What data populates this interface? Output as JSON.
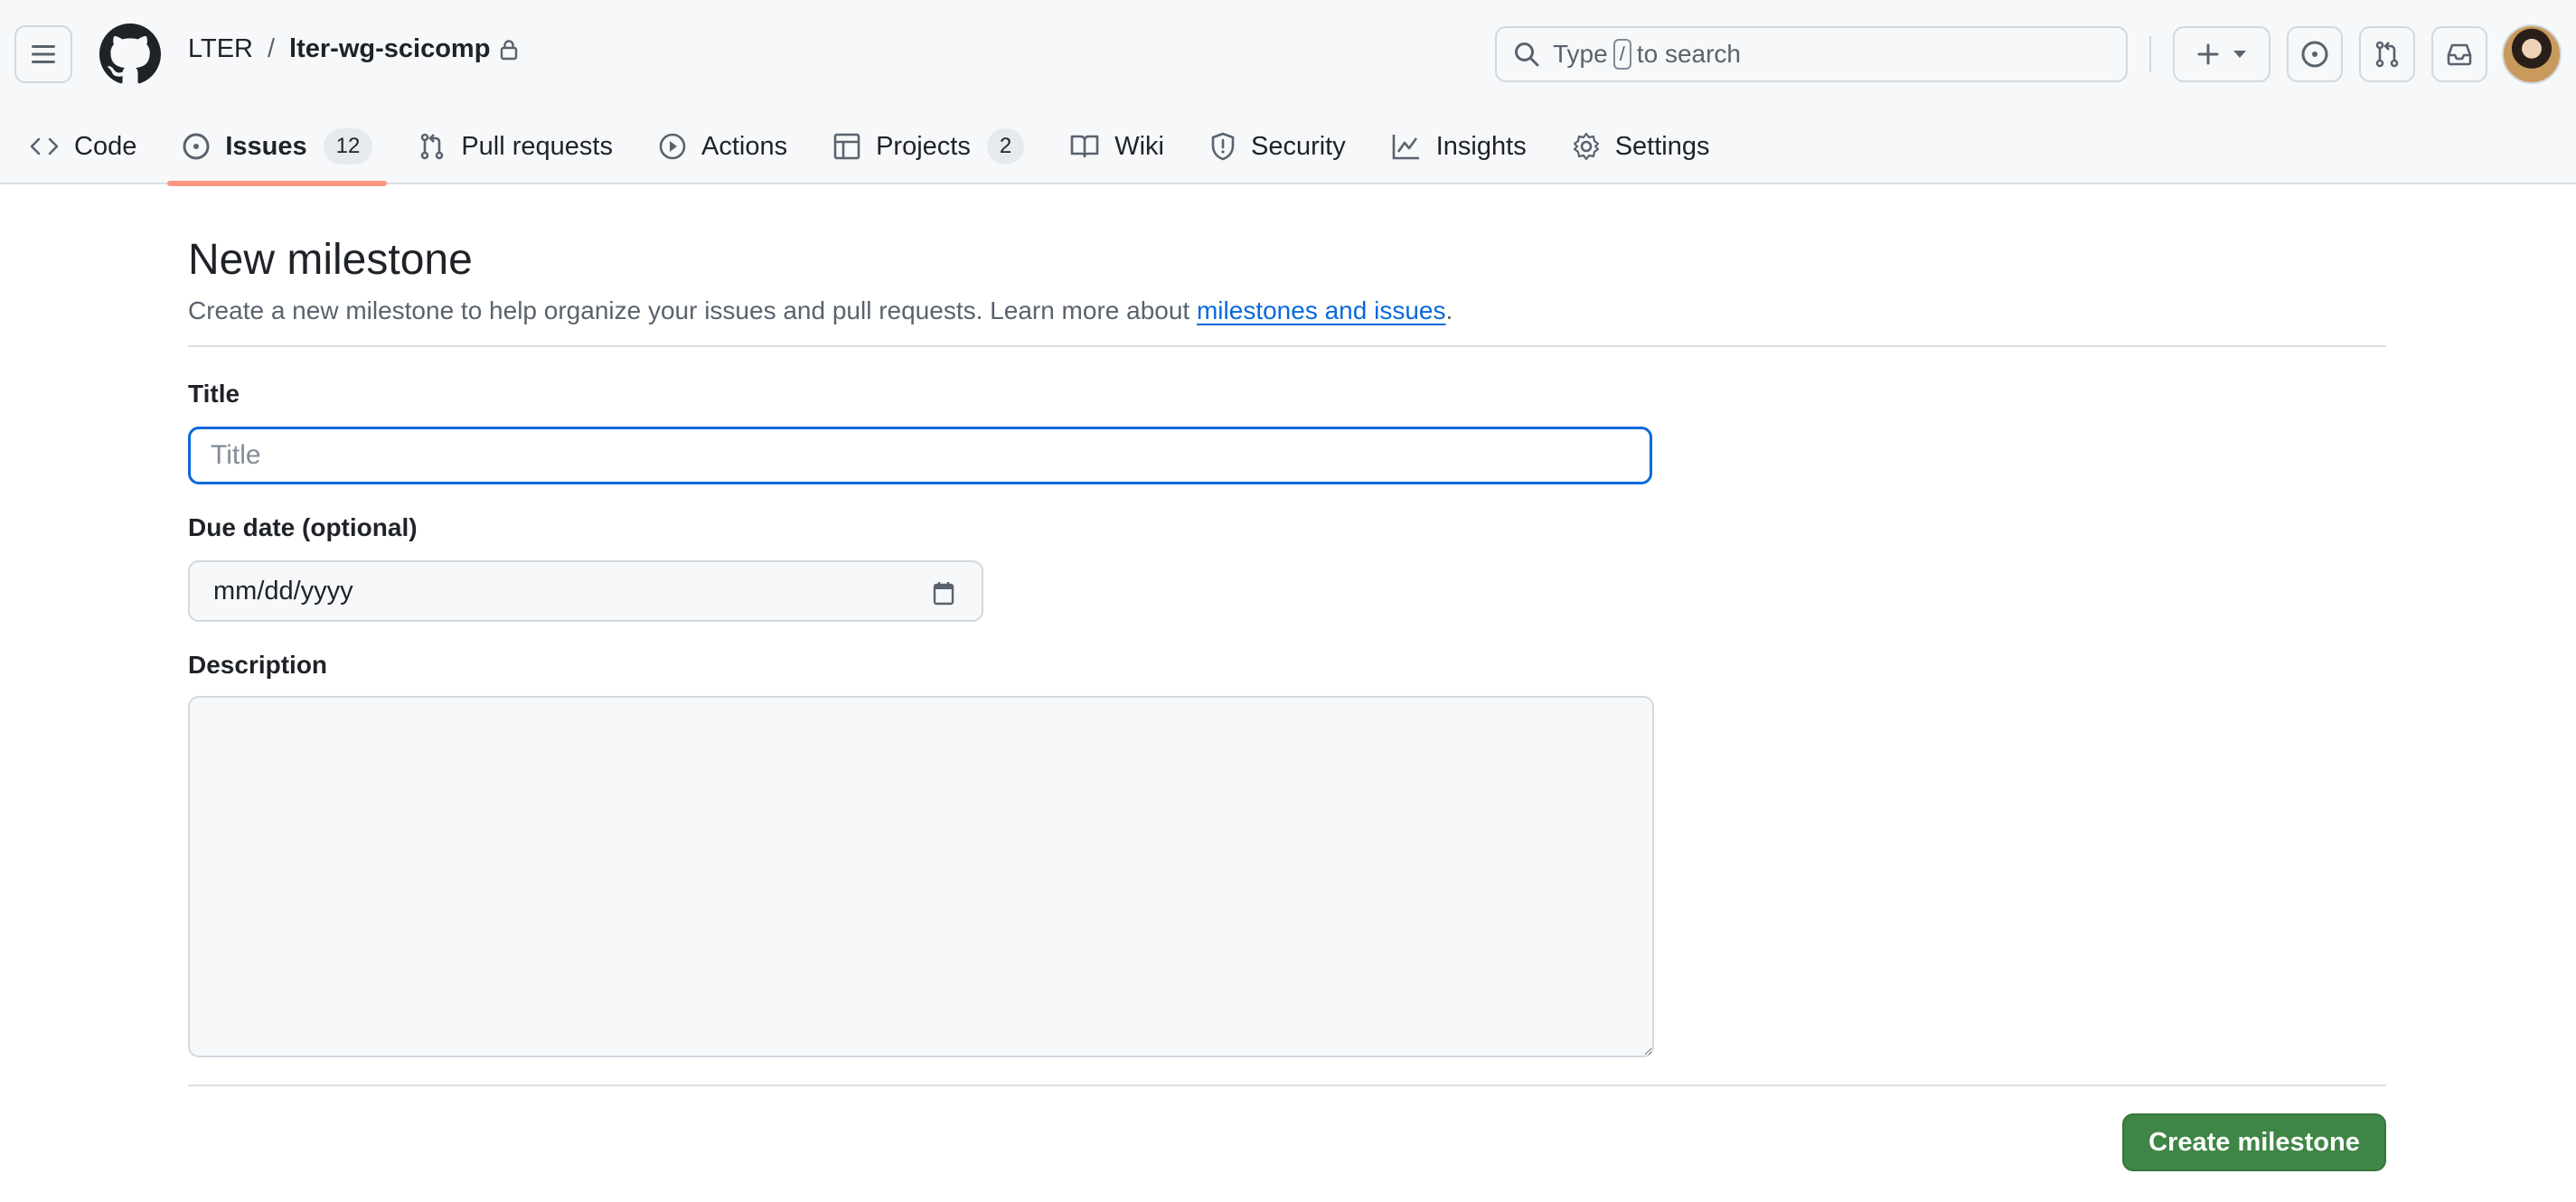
{
  "header": {
    "owner": "LTER",
    "separator": "/",
    "repo": "lter-wg-scicomp",
    "repo_visibility_icon": "lock-icon",
    "search": {
      "prefix": "Type",
      "shortcut_key": "/",
      "suffix": "to search"
    },
    "buttons": [
      "menu-icon",
      "github-logo",
      "plus-icon",
      "issue-opened-icon",
      "git-pull-request-icon",
      "inbox-icon",
      "avatar"
    ]
  },
  "nav": {
    "tabs": [
      {
        "label": "Code",
        "icon": "code-icon"
      },
      {
        "label": "Issues",
        "icon": "issue-opened-icon",
        "count": "12",
        "active": true
      },
      {
        "label": "Pull requests",
        "icon": "git-pull-request-icon"
      },
      {
        "label": "Actions",
        "icon": "play-icon"
      },
      {
        "label": "Projects",
        "icon": "table-icon",
        "count": "2"
      },
      {
        "label": "Wiki",
        "icon": "book-icon"
      },
      {
        "label": "Security",
        "icon": "shield-icon"
      },
      {
        "label": "Insights",
        "icon": "graph-icon"
      },
      {
        "label": "Settings",
        "icon": "gear-icon"
      }
    ],
    "active_underline_color": "#fd8c73"
  },
  "page": {
    "title": "New milestone",
    "subtitle_text": "Create a new milestone to help organize your issues and pull requests. Learn more about ",
    "subtitle_link": "milestones and issues",
    "subtitle_end": "."
  },
  "form": {
    "title_label": "Title",
    "title_placeholder": "Title",
    "title_value": "",
    "due_label": "Due date (optional)",
    "due_placeholder": "mm/dd/yyyy",
    "description_label": "Description",
    "description_value": "",
    "submit_label": "Create milestone",
    "submit_color": "#3f8545",
    "focus_color": "#0969da"
  }
}
